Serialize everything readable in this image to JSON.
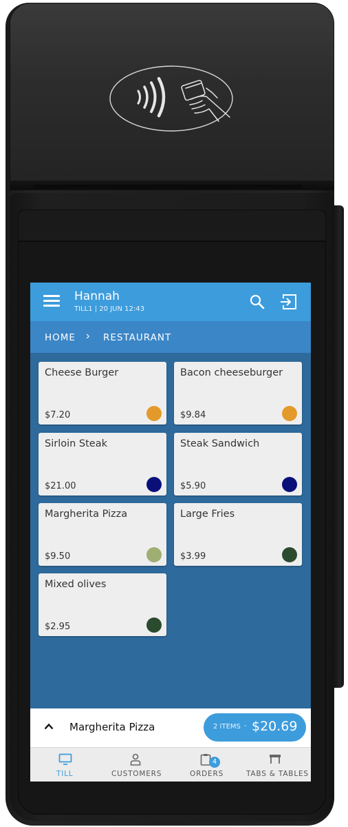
{
  "header": {
    "user_name": "Hannah",
    "till_info": "TILL1 | 20 JUN 12:43"
  },
  "breadcrumb": {
    "items": [
      "HOME",
      "RESTAURANT"
    ],
    "separator": "›"
  },
  "products": [
    {
      "name": "Cheese Burger",
      "price": "$7.20",
      "color": "#e39a2b"
    },
    {
      "name": "Bacon cheeseburger",
      "price": "$9.84",
      "color": "#e39a2b"
    },
    {
      "name": "Sirloin Steak",
      "price": "$21.00",
      "color": "#0b0f7a"
    },
    {
      "name": "Steak Sandwich",
      "price": "$5.90",
      "color": "#0b0f7a"
    },
    {
      "name": "Margherita Pizza",
      "price": "$9.50",
      "color": "#9fae72"
    },
    {
      "name": "Large Fries",
      "price": "$3.99",
      "color": "#2b4b2e"
    },
    {
      "name": "Mixed olives",
      "price": "$2.95",
      "color": "#2b4b2e"
    }
  ],
  "basket": {
    "last_item": "Margherita Pizza",
    "items_count": "2 ITEMS",
    "separator": "-",
    "total": "$20.69"
  },
  "nav": {
    "till": "TILL",
    "customers": "CUSTOMERS",
    "orders": "ORDERS",
    "orders_badge": "4",
    "tables": "TABS & TABLES",
    "active": "till"
  },
  "colors": {
    "appbar": "#3d9cdc",
    "breadcrumb_bar": "#3b86c7",
    "grid_background": "#2e6a9c",
    "accent": "#3d9cdc"
  }
}
